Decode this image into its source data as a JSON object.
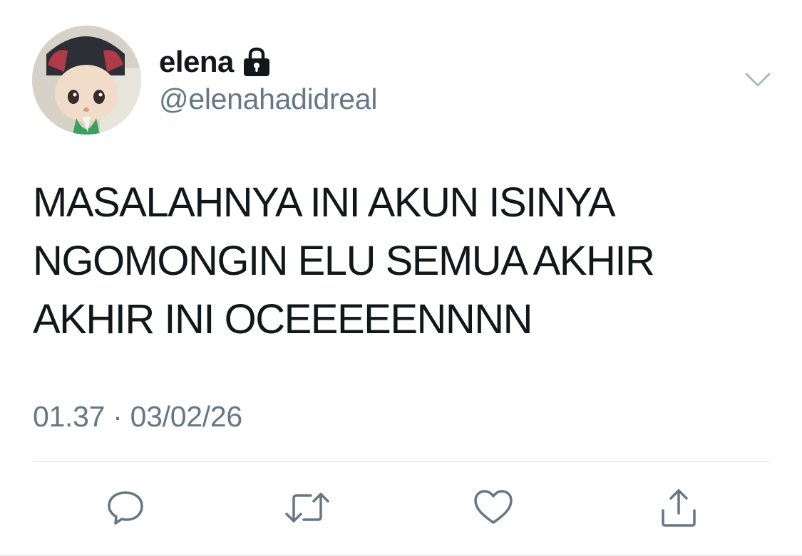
{
  "user": {
    "display_name": "elena",
    "handle": "@elenahadidreal",
    "protected_icon": "lock-icon",
    "avatar_icon": "avatar"
  },
  "tweet": {
    "text": "MASALAHNYA INI AKUN ISINYA\nNGOMONGIN ELU SEMUA AKHIR\nAKHIR INI OCEEEEENNNN",
    "timestamp": "01.37 · 03/02/26"
  },
  "actions": [
    {
      "name": "reply",
      "icon": "reply-icon"
    },
    {
      "name": "retweet",
      "icon": "retweet-icon"
    },
    {
      "name": "like",
      "icon": "heart-icon"
    },
    {
      "name": "share",
      "icon": "share-icon"
    }
  ],
  "colors": {
    "text": "#14171a",
    "secondary": "#657786",
    "divider": "#dfe4e8"
  }
}
